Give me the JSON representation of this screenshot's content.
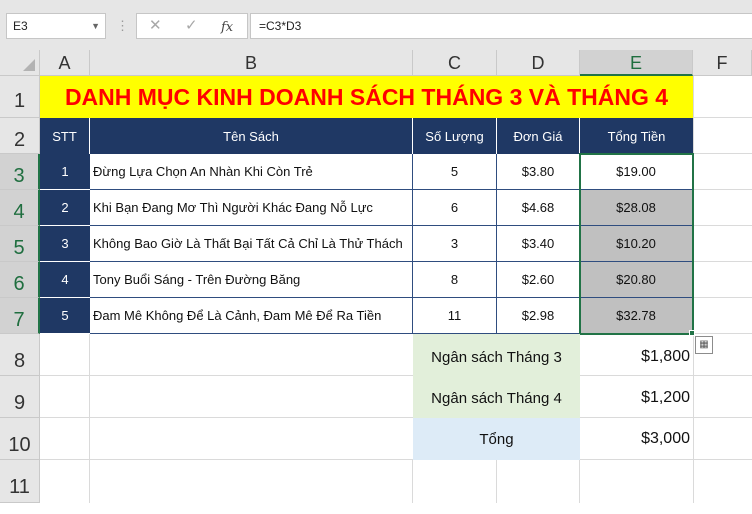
{
  "formula_bar": {
    "name_box": "E3",
    "cancel_glyph": "✕",
    "enter_glyph": "✓",
    "fx_glyph": "fx",
    "formula": "=C3*D3"
  },
  "columns": [
    "A",
    "B",
    "C",
    "D",
    "E",
    "F"
  ],
  "rows": [
    "1",
    "2",
    "3",
    "4",
    "5",
    "6",
    "7",
    "8",
    "9",
    "10",
    "11"
  ],
  "sheet": {
    "title": "DANH MỤC KINH DOANH SÁCH THÁNG 3 VÀ THÁNG 4",
    "headers": {
      "stt": "STT",
      "name": "Tên Sách",
      "qty": "Số Lượng",
      "price": "Đơn Giá",
      "total": "Tổng Tiền"
    },
    "items": [
      {
        "stt": "1",
        "name": "Đừng Lựa Chọn An Nhàn Khi Còn Trẻ",
        "qty": "5",
        "price": "$3.80",
        "total": "$19.00"
      },
      {
        "stt": "2",
        "name": "Khi Bạn Đang Mơ Thì Người Khác Đang Nỗ Lực",
        "qty": "6",
        "price": "$4.68",
        "total": "$28.08"
      },
      {
        "stt": "3",
        "name": "Không Bao Giờ Là Thất Bại Tất Cả Chỉ Là Thử Thách",
        "qty": "3",
        "price": "$3.40",
        "total": "$10.20"
      },
      {
        "stt": "4",
        "name": "Tony Buổi Sáng - Trên Đường Băng",
        "qty": "8",
        "price": "$2.60",
        "total": "$20.80"
      },
      {
        "stt": "5",
        "name": "Đam Mê Không Để Là Cảnh, Đam Mê Để Ra Tiền",
        "qty": "11",
        "price": "$2.98",
        "total": "$32.78"
      }
    ],
    "budget": [
      {
        "label": "Ngân sách Tháng 3",
        "value": "$1,800"
      },
      {
        "label": "Ngân sách Tháng 4",
        "value": "$1,200"
      },
      {
        "label": "Tổng",
        "value": "$3,000"
      }
    ]
  },
  "colors": {
    "title_fill": "#ffff00",
    "title_text": "#ff0000",
    "header_fill": "#1f3864",
    "selection": "#217346",
    "highlight_fill": "#c0c0c0",
    "budget_fill": "#e2efda",
    "total_fill": "#ddebf7"
  },
  "icons": {
    "name_box_dropdown": "chevron-down-icon",
    "quick_analysis": "quick-analysis-icon"
  }
}
